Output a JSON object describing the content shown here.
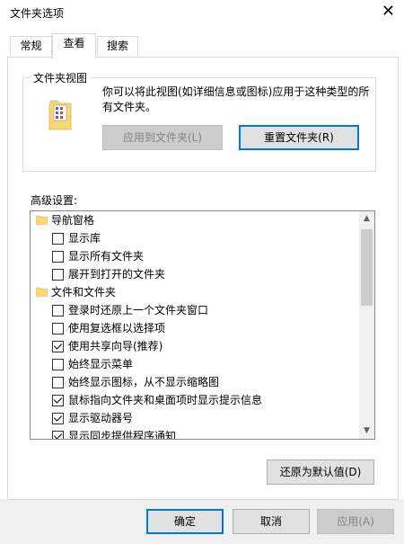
{
  "window": {
    "title": "文件夹选项",
    "close_glyph": "✕"
  },
  "tabs": [
    {
      "label": "常规"
    },
    {
      "label": "查看"
    },
    {
      "label": "搜索"
    }
  ],
  "folder_views": {
    "title": "文件夹视图",
    "description": "你可以将此视图(如详细信息或图标)应用于这种类型的所有文件夹。",
    "apply_label": "应用到文件夹(L)",
    "reset_label": "重置文件夹(R)"
  },
  "advanced": {
    "label": "高级设置:",
    "items": [
      {
        "type": "folder",
        "label": "导航窗格",
        "icon": "folder-open-icon"
      },
      {
        "type": "checkbox",
        "label": "显示库",
        "checked": false
      },
      {
        "type": "checkbox",
        "label": "显示所有文件夹",
        "checked": false
      },
      {
        "type": "checkbox",
        "label": "展开到打开的文件夹",
        "checked": false
      },
      {
        "type": "folder",
        "label": "文件和文件夹",
        "icon": "folder-icon"
      },
      {
        "type": "checkbox",
        "label": "登录时还原上一个文件夹窗口",
        "checked": false
      },
      {
        "type": "checkbox",
        "label": "使用复选框以选择项",
        "checked": false
      },
      {
        "type": "checkbox",
        "label": "使用共享向导(推荐)",
        "checked": true
      },
      {
        "type": "checkbox",
        "label": "始终显示菜单",
        "checked": false
      },
      {
        "type": "checkbox",
        "label": "始终显示图标，从不显示缩略图",
        "checked": false
      },
      {
        "type": "checkbox",
        "label": "鼠标指向文件夹和桌面项时显示提示信息",
        "checked": true
      },
      {
        "type": "checkbox",
        "label": "显示驱动器号",
        "checked": true
      },
      {
        "type": "checkbox",
        "label": "显示同步提供程序通知",
        "checked": true
      }
    ],
    "restore_label": "还原为默认值(D)"
  },
  "footer": {
    "ok_label": "确定",
    "cancel_label": "取消",
    "apply_label": "应用(A)"
  },
  "colors": {
    "accent": "#0078d7",
    "folder": "#f8d775"
  }
}
